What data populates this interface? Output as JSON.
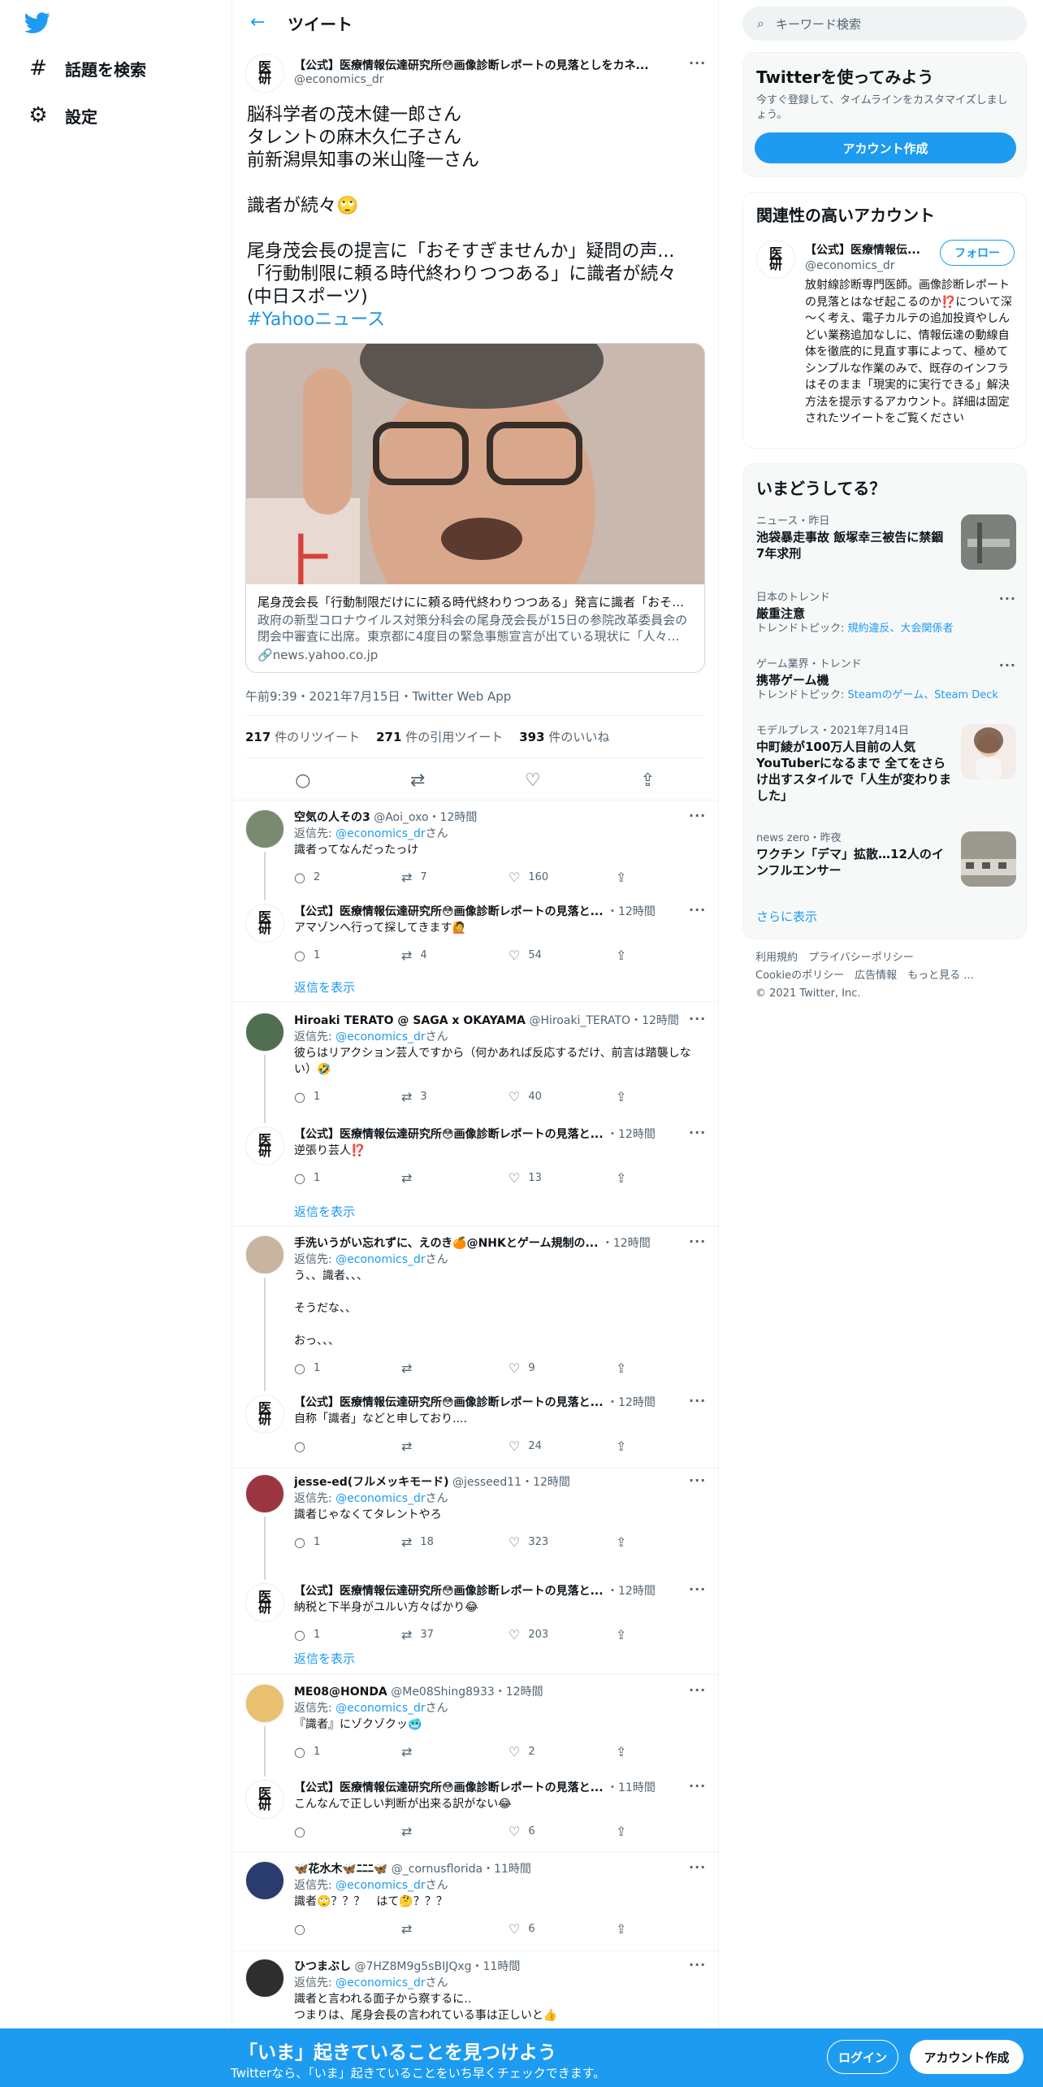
{
  "nav": {
    "search_label": "話題を検索",
    "settings_label": "設定",
    "search_icon": "hashtag-icon",
    "settings_icon": "gear-icon"
  },
  "header": {
    "title": "ツイート"
  },
  "tweet": {
    "author_name": "【公式】医療情報伝達研究所😳画像診断レポートの見落としをカネ...",
    "author_handle": "@economics_dr",
    "lines": [
      "脳科学者の茂木健一郎さん",
      "タレントの麻木久仁子さん",
      "前新潟県知事の米山隆一さん",
      "",
      "識者が続々🙄",
      "",
      "尾身茂会長の提言に「おそすぎませんか」疑問の声...",
      "「行動制限に頼る時代終わりつつある」に識者が続々",
      "(中日スポーツ)"
    ],
    "hashtag": "#Yahooニュース",
    "card": {
      "title": "尾身茂会長「行動制限だけにに頼る時代終わりつつある」発言に識者「おそす…",
      "description": "政府の新型コロナウイルス対策分科会の尾身茂会長が15日の参院改革委員会の閉会中審査に出席。東京都に4度目の緊急事態宣言が出ている現状に「人々…",
      "source": "news.yahoo.co.jp"
    },
    "timestamp": "午前9:39・2021年7月15日・Twitter Web App",
    "retweets": "217",
    "retweets_label": "件のリツイート",
    "quotes": "271",
    "quotes_label": "件の引用ツイート",
    "likes": "393",
    "likes_label": "件のいいね"
  },
  "replies": [
    {
      "name": "空気の人その3",
      "handle": "@Aoi_oxo",
      "time": "・12時間",
      "to_label": "返信先: ",
      "to": "@economics_dr",
      "to_suffix": "さん",
      "text": "識者ってなんだったっけ",
      "reply": "2",
      "rt": "7",
      "like": "160"
    },
    {
      "name": "【公式】医療情報伝達研究所😳画像診断レポートの見落と...",
      "handle": "",
      "time": "・12時間",
      "text": "アマゾンへ行って探してきます🙋",
      "reply": "1",
      "rt": "4",
      "like": "54"
    },
    {
      "name": "Hiroaki TERATO @ SAGA x OKAYAMA",
      "handle": "@Hiroaki_TERATO",
      "time": "・12時間",
      "to_label": "返信先: ",
      "to": "@economics_dr",
      "to_suffix": "さん",
      "text": "彼らはリアクション芸人ですから（何かあれば反応するだけ、前言は踏襲しない）🤣",
      "reply": "1",
      "rt": "3",
      "like": "40"
    },
    {
      "name": "【公式】医療情報伝達研究所😳画像診断レポートの見落と...",
      "handle": "",
      "time": "・12時間",
      "text": "逆張り芸人⁉️",
      "reply": "1",
      "rt": "",
      "like": "13"
    },
    {
      "name": "手洗いうがい忘れずに、えのき🍊@NHKとゲーム規制の...",
      "handle": "",
      "time": "・12時間",
      "to_label": "返信先: ",
      "to": "@economics_dr",
      "to_suffix": "さん",
      "text": "う、、識者、、、\n\nそうだな、、\n\nおっ、、、",
      "reply": "1",
      "rt": "",
      "like": "9"
    },
    {
      "name": "【公式】医療情報伝達研究所😳画像診断レポートの見落と...",
      "handle": "",
      "time": "・12時間",
      "text": "自称「識者」などと申しており....",
      "reply": "",
      "rt": "",
      "like": "24"
    },
    {
      "name": "jesse-ed(フルメッキモード)",
      "handle": "@jesseed11",
      "time": "・12時間",
      "to_label": "返信先: ",
      "to": "@economics_dr",
      "to_suffix": "さん",
      "text": "識者じゃなくてタレントやろ",
      "reply": "1",
      "rt": "18",
      "like": "323"
    },
    {
      "name": "【公式】医療情報伝達研究所😳画像診断レポートの見落と...",
      "handle": "",
      "time": "・12時間",
      "text": "納税と下半身がユルい方々ばかり😂",
      "reply": "1",
      "rt": "37",
      "like": "203"
    },
    {
      "name": "ME08@HONDA",
      "handle": "@Me08Shing8933",
      "time": "・12時間",
      "to_label": "返信先: ",
      "to": "@economics_dr",
      "to_suffix": "さん",
      "text": "『識者』にゾクゾクッ🥶",
      "reply": "1",
      "rt": "",
      "like": "2"
    },
    {
      "name": "【公式】医療情報伝達研究所😳画像診断レポートの見落と...",
      "handle": "",
      "time": "・11時間",
      "text": "こんなんで正しい判断が出来る訳がない😂",
      "reply": "",
      "rt": "",
      "like": "6"
    },
    {
      "name": "🦋花水木🦋ﾆﾆﾆ🦋",
      "handle": "@_cornusflorida",
      "time": "・11時間",
      "to_label": "返信先: ",
      "to": "@economics_dr",
      "to_suffix": "さん",
      "text": "識者🙄？？？　はて🤔？？？",
      "reply": "",
      "rt": "",
      "like": "6"
    },
    {
      "name": "ひつまぶし",
      "handle": "@7HZ8M9g5sBIJQxg",
      "time": "・11時間",
      "to_label": "返信先: ",
      "to": "@economics_dr",
      "to_suffix": "さん",
      "text": "識者と言われる面子から察するに‥\nつまりは、尾身会長の言われている事は正しいと👍",
      "reply": "",
      "rt": "",
      "like": ""
    }
  ],
  "show_replies": "返信を表示",
  "right": {
    "search_placeholder": "キーワード検索",
    "promo_title": "Twitterを使ってみよう",
    "promo_desc": "今すぐ登録して、タイムラインをカスタマイズしましょう。",
    "promo_button": "アカウント作成",
    "related_title": "関連性の高いアカウント",
    "related_name": "【公式】医療情報伝...",
    "related_handle": "@economics_dr",
    "follow_label": "フォロー",
    "related_bio": "放射線診断専門医師。画像診断レポートの見落とはなぜ起こるのか⁉️について深～く考え、電子カルテの追加投資やしんどい業務追加なしに、情報伝達の動線自体を徹底的に見直す事によって、極めてシンプルな作業のみで、既存のインフラはそのまま「現実的に実行できる」解決方法を提示するアカウント。詳細は固定されたツイートをご覧ください",
    "trends_title": "いまどうしてる？",
    "trends": [
      {
        "meta": "ニュース・昨日",
        "title": "池袋暴走事故 飯塚幸三被告に禁錮7年求刑",
        "sub": ""
      },
      {
        "meta": "日本のトレンド",
        "title": "厳重注意",
        "sub_label": "トレンドトピック: ",
        "sub": "規約違反、大会関係者"
      },
      {
        "meta": "ゲーム業界・トレンド",
        "title": "携帯ゲーム機",
        "sub_label": "トレンドトピック: ",
        "sub": "Steamのゲーム、Steam Deck"
      },
      {
        "meta": "モデルプレス・2021年7月14日",
        "title": "中町綾が100万人目前の人気YouTuberになるまで 全てをさらけ出すスタイルで「人生が変わりました」",
        "sub": ""
      },
      {
        "meta": "news zero・昨夜",
        "title": "ワクチン「デマ」拡散…12人のインフルエンサー",
        "sub": ""
      }
    ],
    "show_more": "さらに表示",
    "footer_line1": "利用規約　プライバシーポリシー",
    "footer_line2": "Cookieのポリシー　広告情報　もっと見る ...",
    "footer_line3": "© 2021 Twitter, Inc."
  },
  "bottombar": {
    "title": "「いま」起きていることを見つけよう",
    "subtitle": "Twitterなら、「いま」起きていることをいち早くチェックできます。",
    "login": "ログイン",
    "signup": "アカウント作成"
  }
}
